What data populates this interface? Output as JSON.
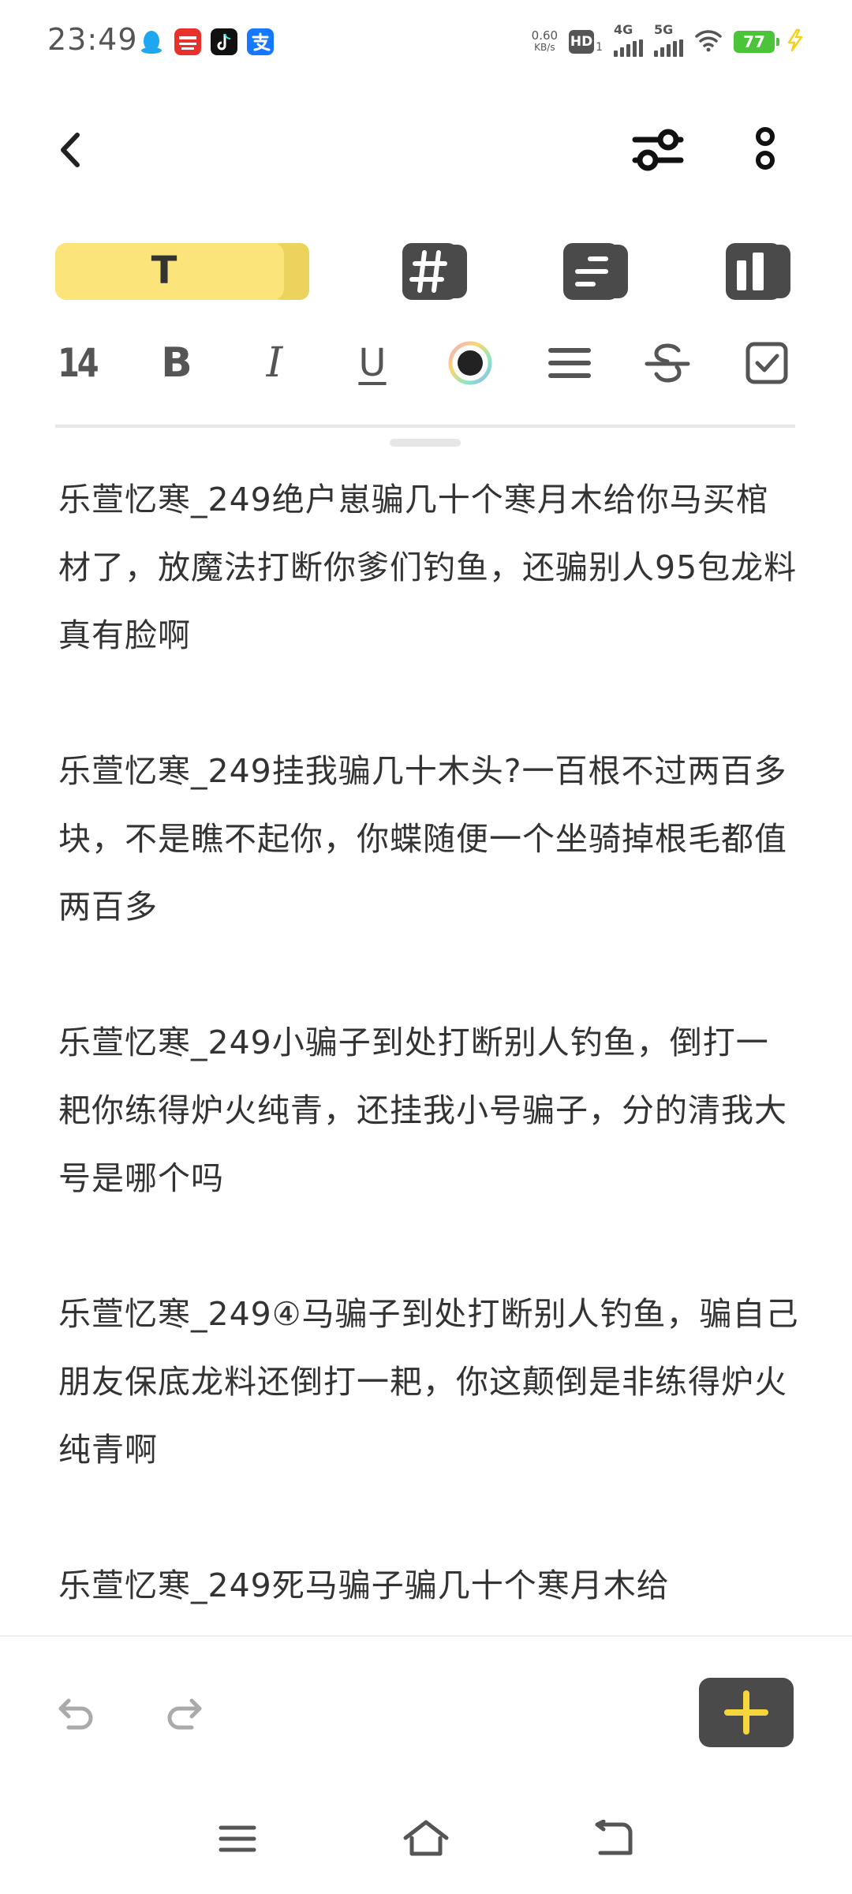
{
  "status_bar": {
    "time": "23:49",
    "net_speed_value": "0.60",
    "net_speed_unit": "KB/s",
    "hd_label": "HD",
    "hd_sub": "1",
    "signal_1_label": "4G",
    "signal_2_label": "5G",
    "battery_level": "77",
    "colors": {
      "battery": "#4cc43a",
      "charging": "#f2d21b"
    }
  },
  "header": {
    "icons": [
      "back-arrow-icon",
      "sliders-icon",
      "more-vertical-icon"
    ]
  },
  "tab_bar": {
    "text_tab_label": "T",
    "tabs": [
      "text-style-tab",
      "hashtag-tab",
      "list-style-tab",
      "layout-tab"
    ],
    "colors": {
      "active": "#fbe57a",
      "active_shadow": "#ecd35d",
      "inactive": "#4a4a4a"
    }
  },
  "format_bar": {
    "font_size": "14",
    "bold_label": "B",
    "italic_label": "I",
    "underline_label": "U",
    "icons": [
      "text-color-icon",
      "align-icon",
      "strikethrough-icon",
      "checkbox-icon"
    ]
  },
  "content": {
    "paragraphs": [
      "乐萱忆寒_249绝户崽骗几十个寒月木给你马买棺材了，放魔法打断你爹们钓鱼，还骗别人95包龙料真有脸啊",
      "乐萱忆寒_249挂我骗几十木头?一百根不过两百多块，不是瞧不起你，你蝶随便一个坐骑掉根毛都值两百多",
      "乐萱忆寒_249小骗子到处打断别人钓鱼，倒打一耙你练得炉火纯青，还挂我小号骗子，分的清我大号是哪个吗",
      "乐萱忆寒_249④马骗子到处打断别人钓鱼，骗自己朋友保底龙料还倒打一耙，你这颠倒是非练得炉火纯青啊",
      "乐萱忆寒_249死马骗子骗几十个寒月木给"
    ]
  },
  "bottom_bar": {
    "icons": [
      "undo-icon",
      "redo-icon",
      "add-icon"
    ],
    "colors": {
      "add_bg": "#4a4a4a",
      "add_plus": "#f5d63d"
    }
  },
  "nav_bar": {
    "icons": [
      "menu-icon",
      "home-icon",
      "back-icon"
    ]
  }
}
